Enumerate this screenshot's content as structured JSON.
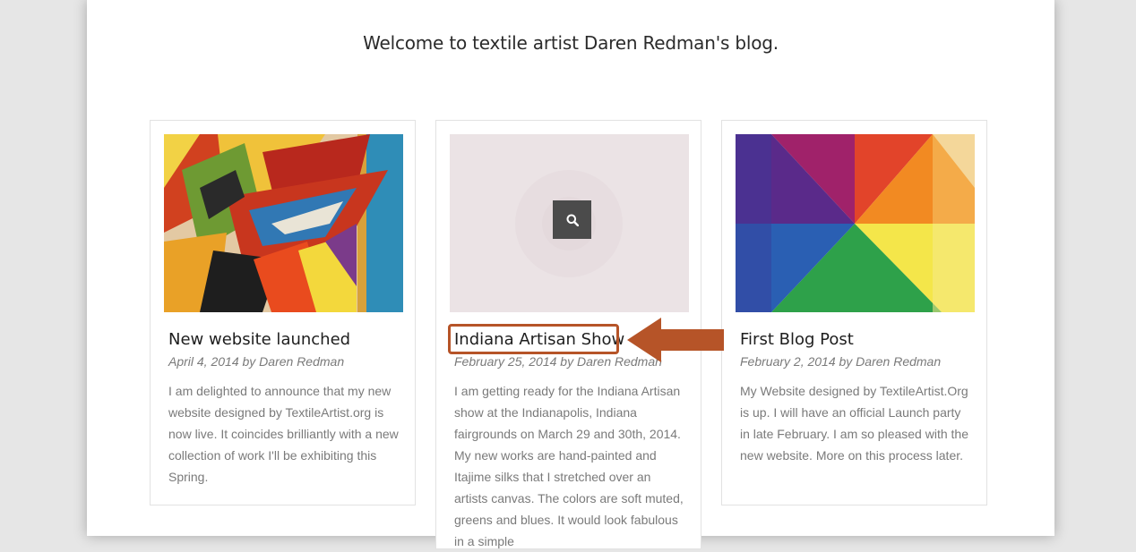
{
  "header": {
    "welcome": "Welcome to textile artist Daren Redman's blog."
  },
  "posts": [
    {
      "title": "New website launched",
      "meta": "April 4, 2014 by Daren Redman",
      "excerpt": "I am delighted to announce that my new website designed by TextileArtist.org is now live. It coincides brilliantly with a new collection of work I'll be exhibiting this Spring."
    },
    {
      "title": "Indiana Artisan Show",
      "meta": "February 25, 2014 by Daren Redman",
      "excerpt": "I am getting ready for the Indiana Artisan show at the Indianapolis, Indiana fairgrounds on March 29 and 30th, 2014. My new works are hand-painted and Itajime silks that I stretched over an artists canvas. The colors are soft muted, greens and blues. It would look fabulous in a simple"
    },
    {
      "title": "First Blog Post",
      "meta": "February 2, 2014 by Daren Redman",
      "excerpt": "My Website designed by TextileArtist.Org is up. I will have an official Launch party in late February. I am so pleased with the new website. More on this process later."
    }
  ],
  "icons": {
    "search": "search-icon",
    "arrow": "arrow-left-icon"
  },
  "colors": {
    "annotation": "#b65428",
    "text": "#1e1e1e",
    "muted": "#7a7a7a"
  }
}
